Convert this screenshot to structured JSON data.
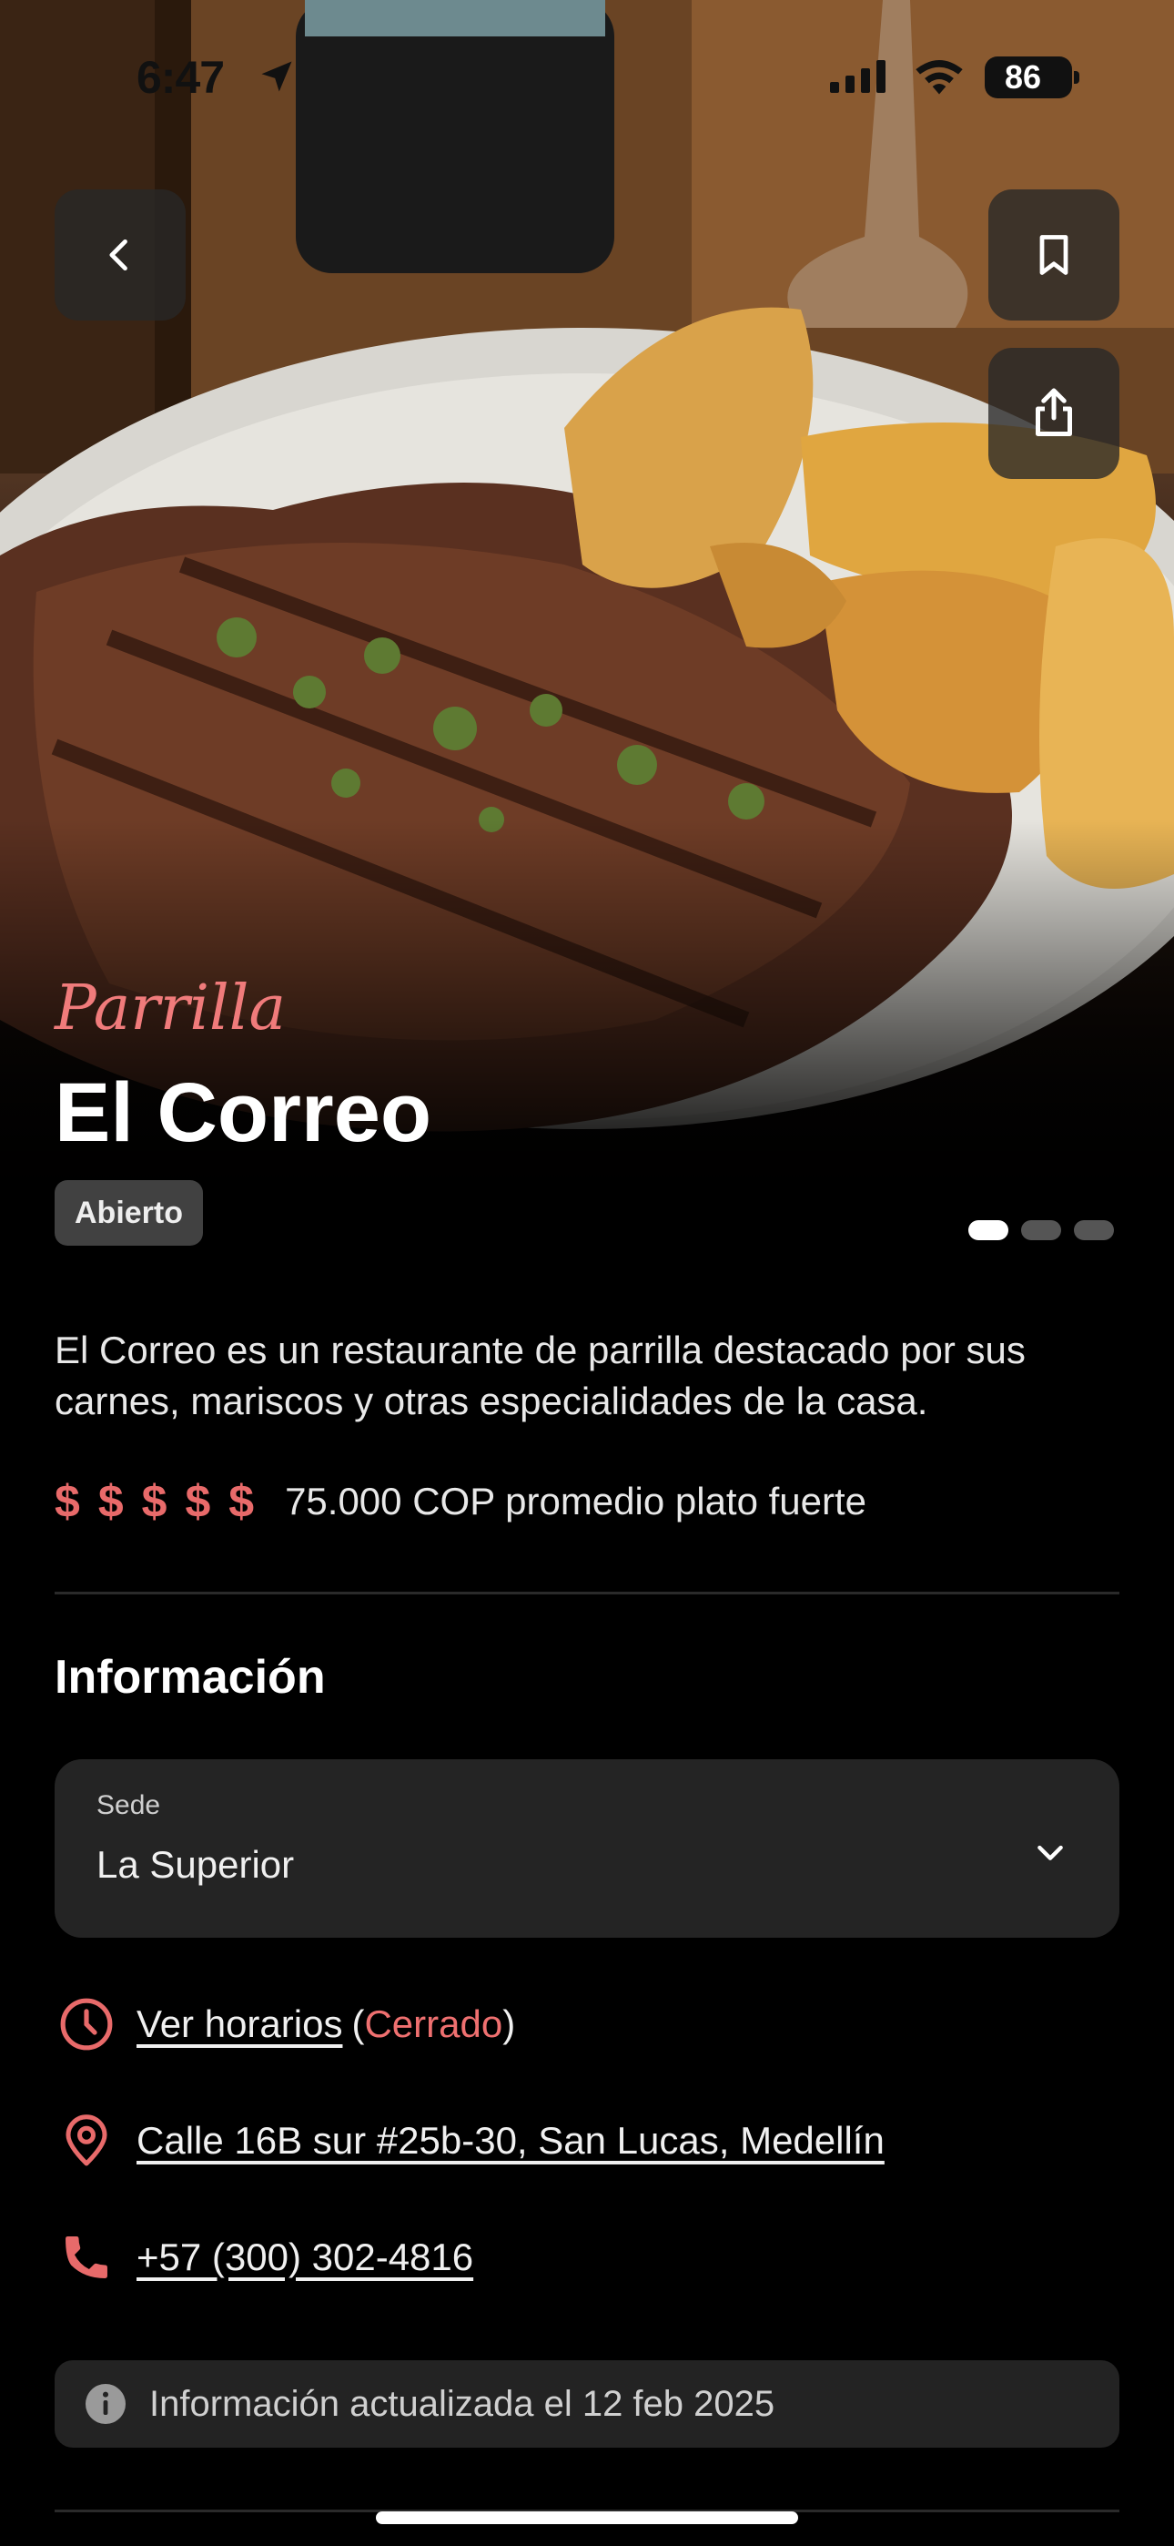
{
  "status_bar": {
    "time": "6:47",
    "battery": "86"
  },
  "hero": {
    "category": "Parrilla",
    "title": "El Correo",
    "status_badge": "Abierto",
    "carousel": {
      "pages": 3,
      "active": 1
    }
  },
  "description": "El Correo es un restaurante de parrilla destacado por sus carnes, mariscos y otras especialidades de la casa.",
  "price": {
    "symbols": [
      "$",
      "$",
      "$",
      "$",
      "$"
    ],
    "text": "75.000 COP promedio plato fuerte"
  },
  "info": {
    "title": "Información",
    "location_select": {
      "label": "Sede",
      "value": "La Superior"
    },
    "hours": {
      "link": "Ver horarios",
      "open_paren": "(",
      "status": "Cerrado",
      "close_paren": ")"
    },
    "address": "Calle 16B sur #25b-30, San Lucas, Medellín",
    "phone": "+57 (300) 302-4816",
    "updated_note": "Información actualizada el 12 feb 2025"
  },
  "colors": {
    "accent": "#e86a6a",
    "background": "#000000",
    "card": "#242424"
  },
  "icons": [
    "back-chevron-icon",
    "bookmark-icon",
    "share-icon",
    "chevron-down-icon",
    "clock-icon",
    "location-pin-icon",
    "phone-icon",
    "info-icon"
  ]
}
